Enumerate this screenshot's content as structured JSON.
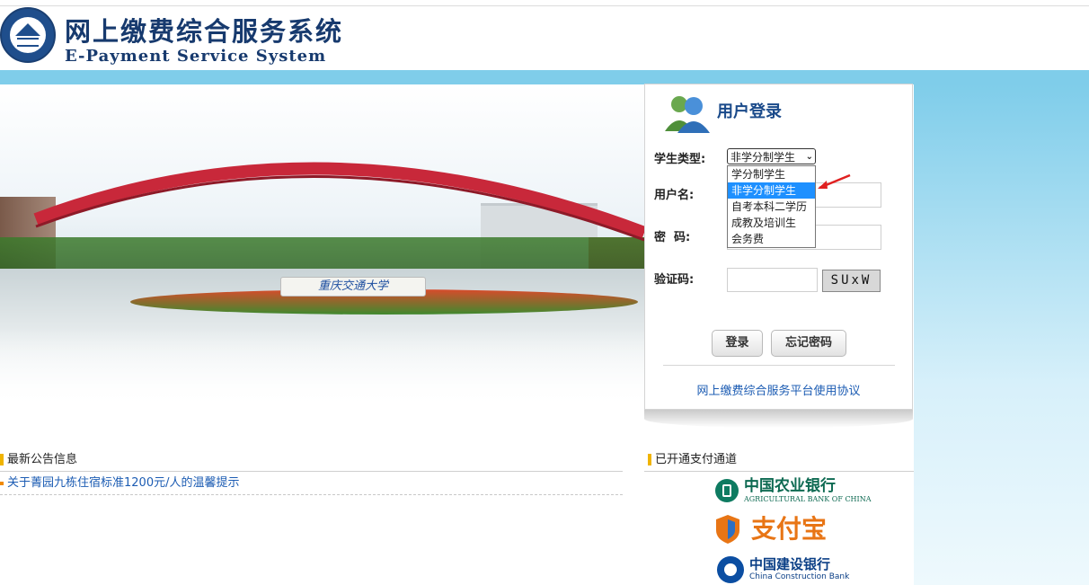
{
  "header": {
    "title_cn": "网上缴费综合服务系统",
    "title_en": "E-Payment Service System"
  },
  "banner": {
    "stone_text": "重庆交通大学"
  },
  "login": {
    "title": "用户登录",
    "student_type_label": "学生类型:",
    "student_type_selected": "非学分制学生",
    "student_type_options": [
      "学分制学生",
      "非学分制学生",
      "自考本科二学历",
      "成教及培训生",
      "会务费"
    ],
    "username_label": "用户名:",
    "password_label": "密  码:",
    "captcha_label": "验证码:",
    "captcha_text": "SUxW",
    "login_button": "登录",
    "forgot_button": "忘记密码",
    "agreement_link": "网上缴费综合服务平台使用协议"
  },
  "notices": {
    "heading": "最新公告信息",
    "items": [
      "关于菁园九栋住宿标准1200元/人的温馨提示"
    ]
  },
  "payment": {
    "heading": "已开通支付通道",
    "banks": {
      "abc_cn": "中国农业银行",
      "abc_en": "AGRICULTURAL BANK OF CHINA",
      "alipay": "支付宝",
      "ccb_cn": "中国建设银行",
      "ccb_en": "China Construction Bank"
    }
  },
  "colors": {
    "brand_blue": "#173a6e",
    "sky": "#7fcdea",
    "link": "#1c5cb3",
    "highlight": "#1e90ff"
  }
}
